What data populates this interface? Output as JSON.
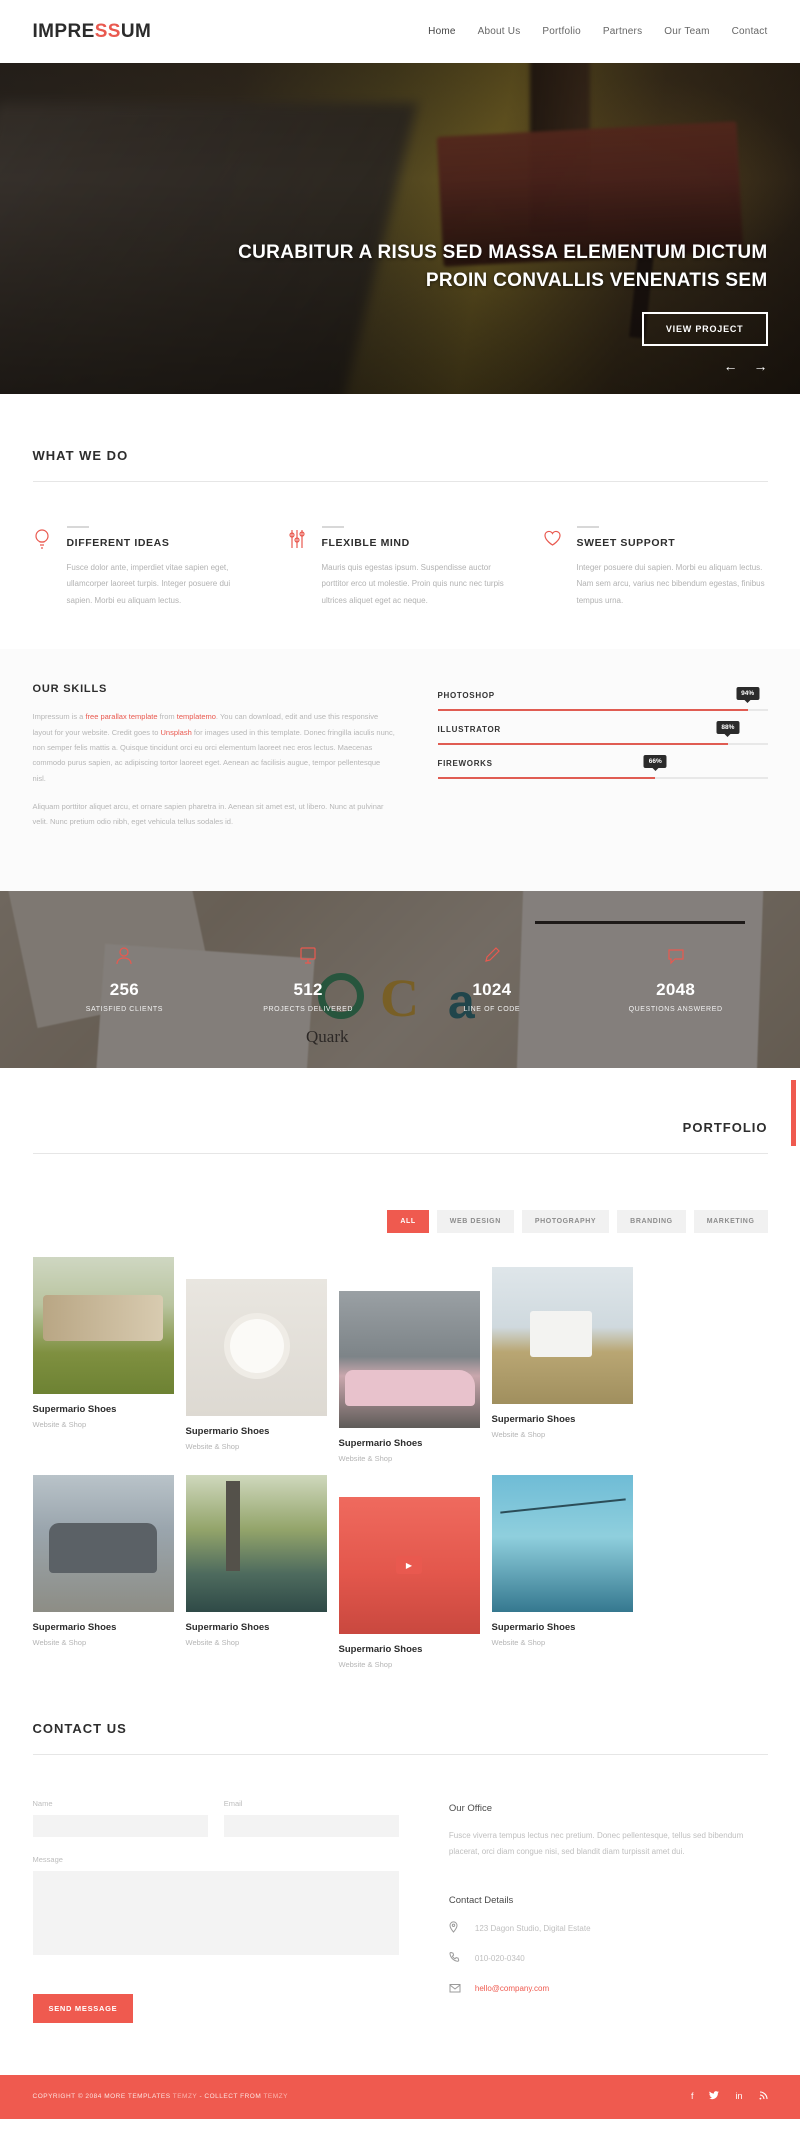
{
  "header": {
    "logo_part1": "IMPRE",
    "logo_highlight": "SS",
    "logo_part2": "UM",
    "nav": [
      {
        "label": "Home"
      },
      {
        "label": "About Us"
      },
      {
        "label": "Portfolio"
      },
      {
        "label": "Partners"
      },
      {
        "label": "Our Team"
      },
      {
        "label": "Contact"
      }
    ]
  },
  "hero": {
    "title_line1": "CURABITUR A RISUS SED MASSA ELEMENTUM DICTUM",
    "title_line2": "PROIN CONVALLIS VENENATIS SEM",
    "button_label": "VIEW PROJECT",
    "prev_arrow": "←",
    "next_arrow": "→"
  },
  "what_we_do": {
    "title": "WHAT WE DO",
    "services": [
      {
        "icon": "lightbulb-icon",
        "heading": "DIFFERENT IDEAS",
        "text": "Fusce dolor ante, imperdiet vitae sapien eget, ullamcorper laoreet turpis. Integer posuere dui sapien. Morbi eu aliquam lectus."
      },
      {
        "icon": "sliders-icon",
        "heading": "FLEXIBLE MIND",
        "text": "Mauris quis egestas ipsum. Suspendisse auctor porttitor erco ut molestie. Proin quis nunc nec turpis ultrices aliquet eget ac neque."
      },
      {
        "icon": "heart-icon",
        "heading": "SWEET SUPPORT",
        "text": "Integer posuere dui sapien. Morbi eu aliquam lectus. Nam sem arcu, varius nec bibendum egestas, finibus tempus urna."
      }
    ]
  },
  "skills": {
    "title": "OUR SKILLS",
    "paragraph1_pre": "Impressum is a ",
    "paragraph1_link1": "free parallax template",
    "paragraph1_mid": " from ",
    "paragraph1_link2": "templatemo",
    "paragraph1_post": ". You can download, edit and use this responsive layout for your website. Credit goes to ",
    "paragraph1_link3": "Unsplash",
    "paragraph1_tail": " for images used in this template. Donec fringilla iaculis nunc, non semper felis mattis a. Quisque tincidunt orci eu orci elementum laoreet nec eros lectus. Maecenas commodo purus sapien, ac adipiscing tortor laoreet eget. Aenean ac facilisis augue, tempor pellentesque nisl.",
    "paragraph2": "Aliquam porttitor aliquet arcu, et ornare sapien pharetra in. Aenean sit amet est, ut libero. Nunc at pulvinar velit. Nunc pretium odio nibh, eget vehicula tellus sodales id.",
    "bars": [
      {
        "label": "PHOTOSHOP",
        "value": 94,
        "display": "94%"
      },
      {
        "label": "ILLUSTRATOR",
        "value": 88,
        "display": "88%"
      },
      {
        "label": "FIREWORKS",
        "value": 66,
        "display": "66%"
      }
    ]
  },
  "counters": [
    {
      "icon": "user-icon",
      "number": "256",
      "label": "SATISFIED CLIENTS"
    },
    {
      "icon": "monitor-icon",
      "number": "512",
      "label": "PROJECTS DELIVERED"
    },
    {
      "icon": "pen-icon",
      "number": "1024",
      "label": "LINE OF CODE"
    },
    {
      "icon": "chat-icon",
      "number": "2048",
      "label": "QUESTIONS ANSWERED"
    }
  ],
  "portfolio": {
    "title": "PORTFOLIO",
    "filters": [
      {
        "label": "ALL",
        "active": true
      },
      {
        "label": "WEB DESIGN",
        "active": false
      },
      {
        "label": "PHOTOGRAPHY",
        "active": false
      },
      {
        "label": "BRANDING",
        "active": false
      },
      {
        "label": "MARKETING",
        "active": false
      }
    ],
    "items": [
      {
        "title": "Supermario Shoes",
        "subtitle": "Website & Shop",
        "thumb": "fence-photo"
      },
      {
        "title": "Supermario Shoes",
        "subtitle": "Website & Shop",
        "thumb": "bowl-photo"
      },
      {
        "title": "Supermario Shoes",
        "subtitle": "Website & Shop",
        "thumb": "cars-photo"
      },
      {
        "title": "Supermario Shoes",
        "subtitle": "Website & Shop",
        "thumb": "chair-photo"
      },
      {
        "title": "Supermario Shoes",
        "subtitle": "Website & Shop",
        "thumb": "van-photo"
      },
      {
        "title": "Supermario Shoes",
        "subtitle": "Website & Shop",
        "thumb": "pier-photo"
      },
      {
        "title": "Supermario Shoes",
        "subtitle": "Website & Shop",
        "thumb": "video-photo"
      },
      {
        "title": "Supermario Shoes",
        "subtitle": "Website & Shop",
        "thumb": "cablecar-photo"
      }
    ]
  },
  "contact": {
    "title": "CONTACT US",
    "form": {
      "name_label": "Name",
      "name_value": "",
      "name_placeholder": "",
      "email_label": "Email",
      "email_value": "",
      "email_placeholder": "",
      "message_label": "Message",
      "message_value": "",
      "message_placeholder": "",
      "submit_label": "SEND MESSAGE"
    },
    "office_heading": "Our Office",
    "office_text": "Fusce viverra tempus lectus nec pretium. Donec pellentesque, tellus sed bibendum placerat, orci diam congue nisi, sed blandit diam turpissit amet dui.",
    "details_heading": "Contact Details",
    "details": [
      {
        "icon": "map-pin-icon",
        "text": "123 Dagon Studio, Digital Estate",
        "kind": "address"
      },
      {
        "icon": "phone-icon",
        "text": "010-020-0340",
        "kind": "phone"
      },
      {
        "icon": "envelope-icon",
        "text": "hello@company.com",
        "kind": "email"
      }
    ]
  },
  "footer": {
    "copyright_pre": "COPYRIGHT © 2084 MORE TEMPLATES ",
    "link1": "TEMZY",
    "copyright_mid": " - COLLECT FROM ",
    "link2": "TEMZY",
    "social": [
      {
        "icon": "facebook-icon",
        "glyph": "f"
      },
      {
        "icon": "twitter-icon",
        "glyph": "ᵛ"
      },
      {
        "icon": "linkedin-icon",
        "glyph": "in"
      },
      {
        "icon": "rss-icon",
        "glyph": "ʀ"
      }
    ]
  },
  "colors": {
    "accent": "#ef5a4f",
    "dark": "#2b2b2b",
    "muted": "#bfbfbf"
  }
}
